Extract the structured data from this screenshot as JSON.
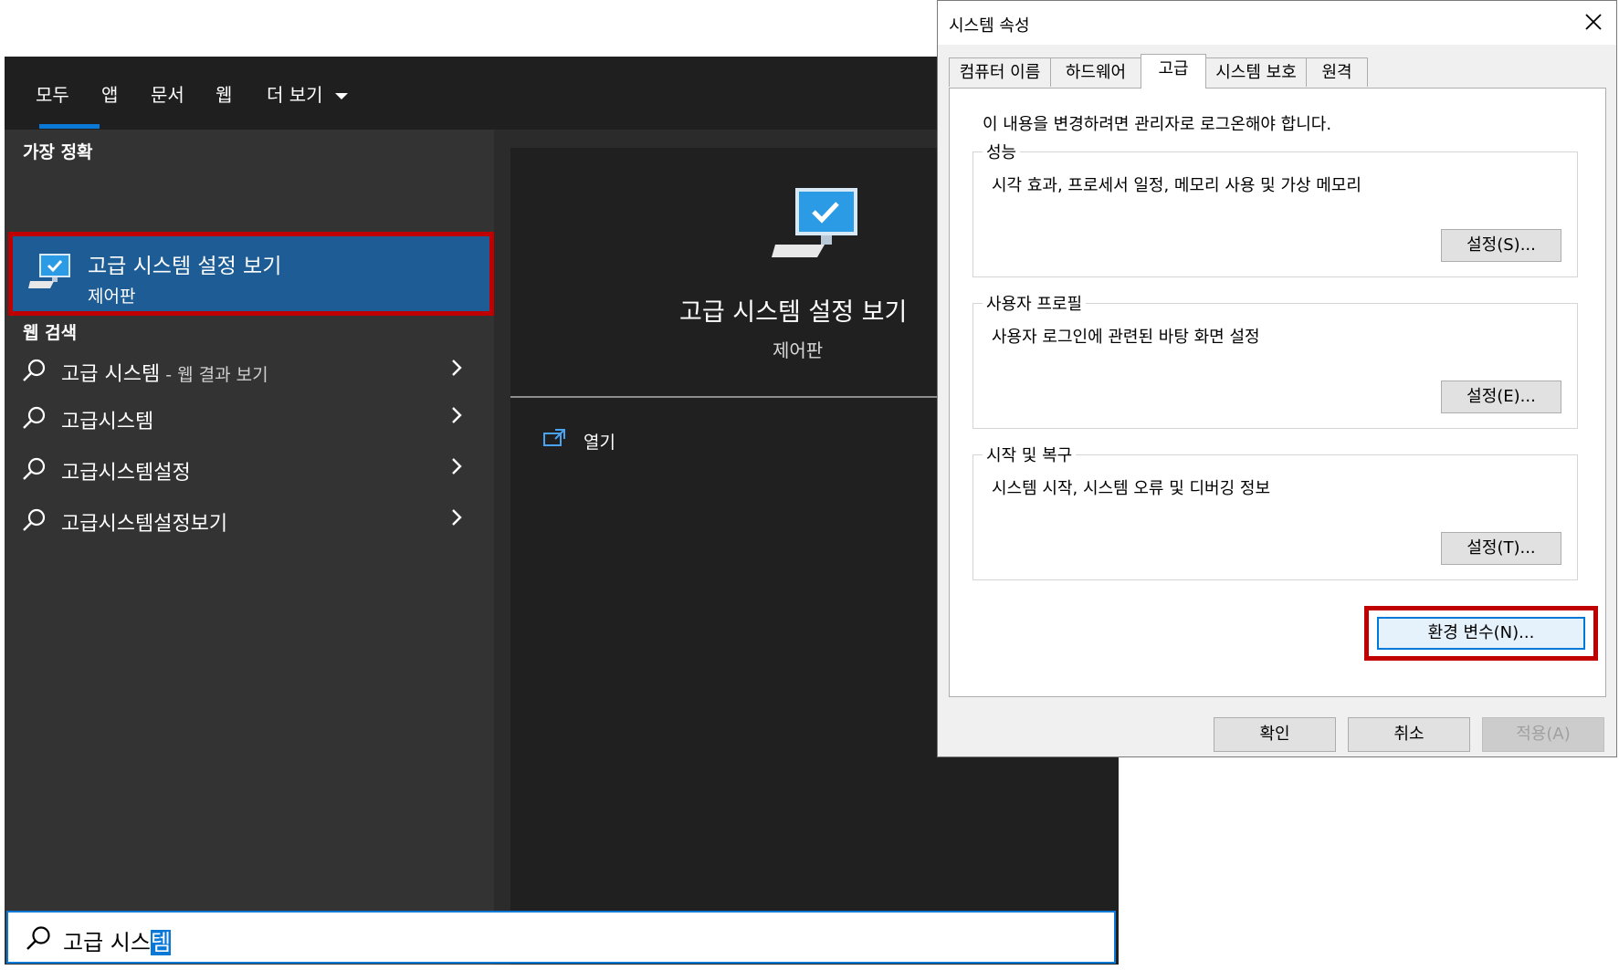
{
  "start_menu": {
    "tabs": [
      "모두",
      "앱",
      "문서",
      "웹",
      "더 보기"
    ],
    "best_match_label": "가장 정확",
    "best_match": {
      "title": "고급 시스템 설정 보기",
      "subtitle": "제어판"
    },
    "web_search_label": "웹 검색",
    "web_results": [
      {
        "text": "고급 시스템",
        "suffix": " - 웹 결과 보기"
      },
      {
        "text": "고급시스템",
        "suffix": ""
      },
      {
        "text": "고급시스템설정",
        "suffix": ""
      },
      {
        "text": "고급시스템설정보기",
        "suffix": ""
      }
    ],
    "preview": {
      "title": "고급 시스템 설정 보기",
      "subtitle": "제어판",
      "open_label": "열기"
    },
    "search": {
      "typed": "고급 시스",
      "selected": "템"
    }
  },
  "dialog": {
    "title": "시스템 속성",
    "tabs": [
      "컴퓨터 이름",
      "하드웨어",
      "고급",
      "시스템 보호",
      "원격"
    ],
    "active_tab": "고급",
    "admin_note": "이 내용을 변경하려면 관리자로 로그온해야 합니다.",
    "groups": [
      {
        "legend": "성능",
        "description": "시각 효과, 프로세서 일정, 메모리 사용 및 가상 메모리",
        "button": "설정(S)..."
      },
      {
        "legend": "사용자 프로필",
        "description": "사용자 로그인에 관련된 바탕 화면 설정",
        "button": "설정(E)..."
      },
      {
        "legend": "시작 및 복구",
        "description": "시스템 시작, 시스템 오류 및 디버깅 정보",
        "button": "설정(T)..."
      }
    ],
    "env_button": "환경 변수(N)...",
    "ok": "확인",
    "cancel": "취소",
    "apply": "적용(A)"
  },
  "colors": {
    "accent": "#0a78d7",
    "highlight_box": "#c00000",
    "best_match_bg": "#1d5c95"
  }
}
